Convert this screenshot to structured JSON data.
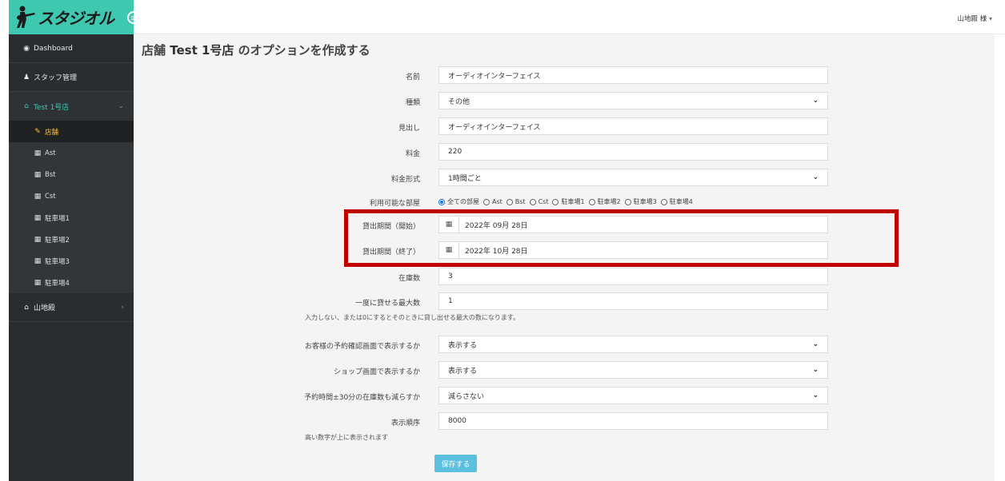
{
  "brand": {
    "logo_text": "スタジオル",
    "accent": "#3fc8b0"
  },
  "header": {
    "user_name": "山地殿",
    "user_suffix": "様",
    "caret": "▾"
  },
  "sidebar": {
    "items": [
      {
        "label": "Dashboard",
        "icon": "dashboard-icon"
      },
      {
        "label": "スタッフ管理",
        "icon": "user-icon"
      },
      {
        "label": "Test 1号店",
        "icon": "home-icon"
      },
      {
        "label": "店舗",
        "icon": "wrench-icon"
      },
      {
        "label": "Ast",
        "icon": "calendar-icon"
      },
      {
        "label": "Bst",
        "icon": "calendar-icon"
      },
      {
        "label": "Cst",
        "icon": "calendar-icon"
      },
      {
        "label": "駐車場1",
        "icon": "calendar-icon"
      },
      {
        "label": "駐車場2",
        "icon": "calendar-icon"
      },
      {
        "label": "駐車場3",
        "icon": "calendar-icon"
      },
      {
        "label": "駐車場4",
        "icon": "calendar-icon"
      },
      {
        "label": "山地殿",
        "icon": "home-icon"
      }
    ]
  },
  "page": {
    "title_prefix": "店舗 ",
    "title_store": "Test 1号店",
    "title_suffix": " のオプションを作成する"
  },
  "form": {
    "name": {
      "label": "名前",
      "value": "オーディオインターフェイス"
    },
    "type": {
      "label": "種類",
      "value": "その他"
    },
    "heading": {
      "label": "見出し",
      "value": "オーディオインターフェイス"
    },
    "price": {
      "label": "料金",
      "value": "220"
    },
    "price_type": {
      "label": "料金形式",
      "value": "1時間ごと"
    },
    "rooms": {
      "label": "利用可能な部屋",
      "options": [
        "全ての部屋",
        "Ast",
        "Bst",
        "Cst",
        "駐車場1",
        "駐車場2",
        "駐車場3",
        "駐車場4"
      ],
      "selected": "全ての部屋"
    },
    "rent_start": {
      "label": "貸出期間（開始）",
      "value": "2022年 09月 28日"
    },
    "rent_end": {
      "label": "貸出期間（終了）",
      "value": "2022年 10月 28日"
    },
    "stock": {
      "label": "在庫数",
      "value": "3"
    },
    "max_rent": {
      "label": "一度に貸せる最大数",
      "value": "1",
      "help": "入力しない、または0にするとそのときに貸し出せる最大の数になります。"
    },
    "show_confirm": {
      "label": "お客様の予約確認画面で表示するか",
      "value": "表示する"
    },
    "show_shop": {
      "label": "ショップ画面で表示するか",
      "value": "表示する"
    },
    "reduce_stock": {
      "label": "予約時間±30分の在庫数も減らすか",
      "value": "減らさない"
    },
    "order": {
      "label": "表示順序",
      "value": "8000",
      "help": "高い数字が上に表示されます"
    },
    "save_label": "保存する"
  },
  "annotation_color": "#c00000"
}
